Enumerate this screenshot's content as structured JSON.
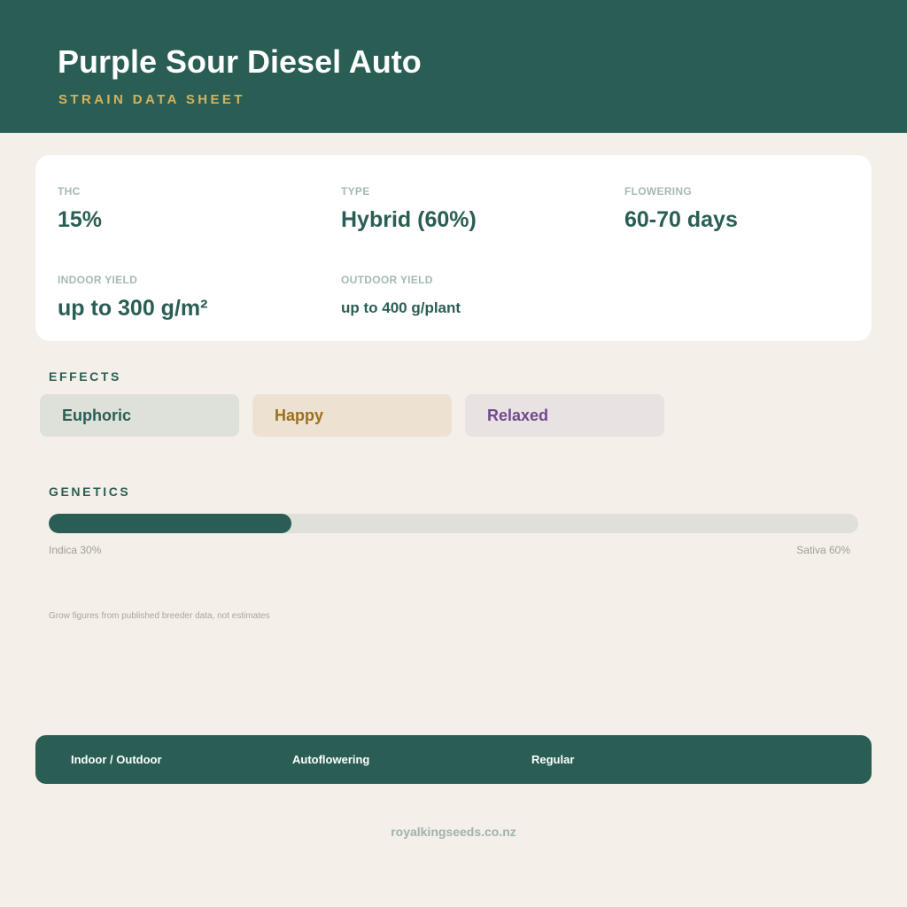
{
  "header": {
    "title": "Purple Sour Diesel Auto",
    "subtitle": "STRAIN DATA SHEET"
  },
  "stats": {
    "thc": {
      "label": "THC",
      "value": "15%"
    },
    "type": {
      "label": "TYPE",
      "value": "Hybrid (60%)"
    },
    "flowering": {
      "label": "FLOWERING",
      "value": "60-70 days"
    },
    "indoor_yield": {
      "label": "INDOOR YIELD",
      "value": "up to 300 g/m²"
    },
    "outdoor_yield": {
      "label": "OUTDOOR YIELD",
      "value": "up to 400 g/plant"
    }
  },
  "effects": {
    "heading": "EFFECTS",
    "items": [
      "Euphoric",
      "Happy",
      "Relaxed"
    ]
  },
  "genetics": {
    "heading": "GENETICS",
    "indica_label": "Indica 30%",
    "sativa_label": "Sativa 60%",
    "indica_percent": 30
  },
  "footnote": "Grow figures from published breeder data, not estimates",
  "footer": {
    "items": [
      "Indoor / Outdoor",
      "Autoflowering",
      "Regular"
    ]
  },
  "website": "royalkingseeds.co.nz",
  "colors": {
    "brand_green": "#2a5e55",
    "accent_gold": "#d4b35c",
    "background": "#f4efe9"
  }
}
